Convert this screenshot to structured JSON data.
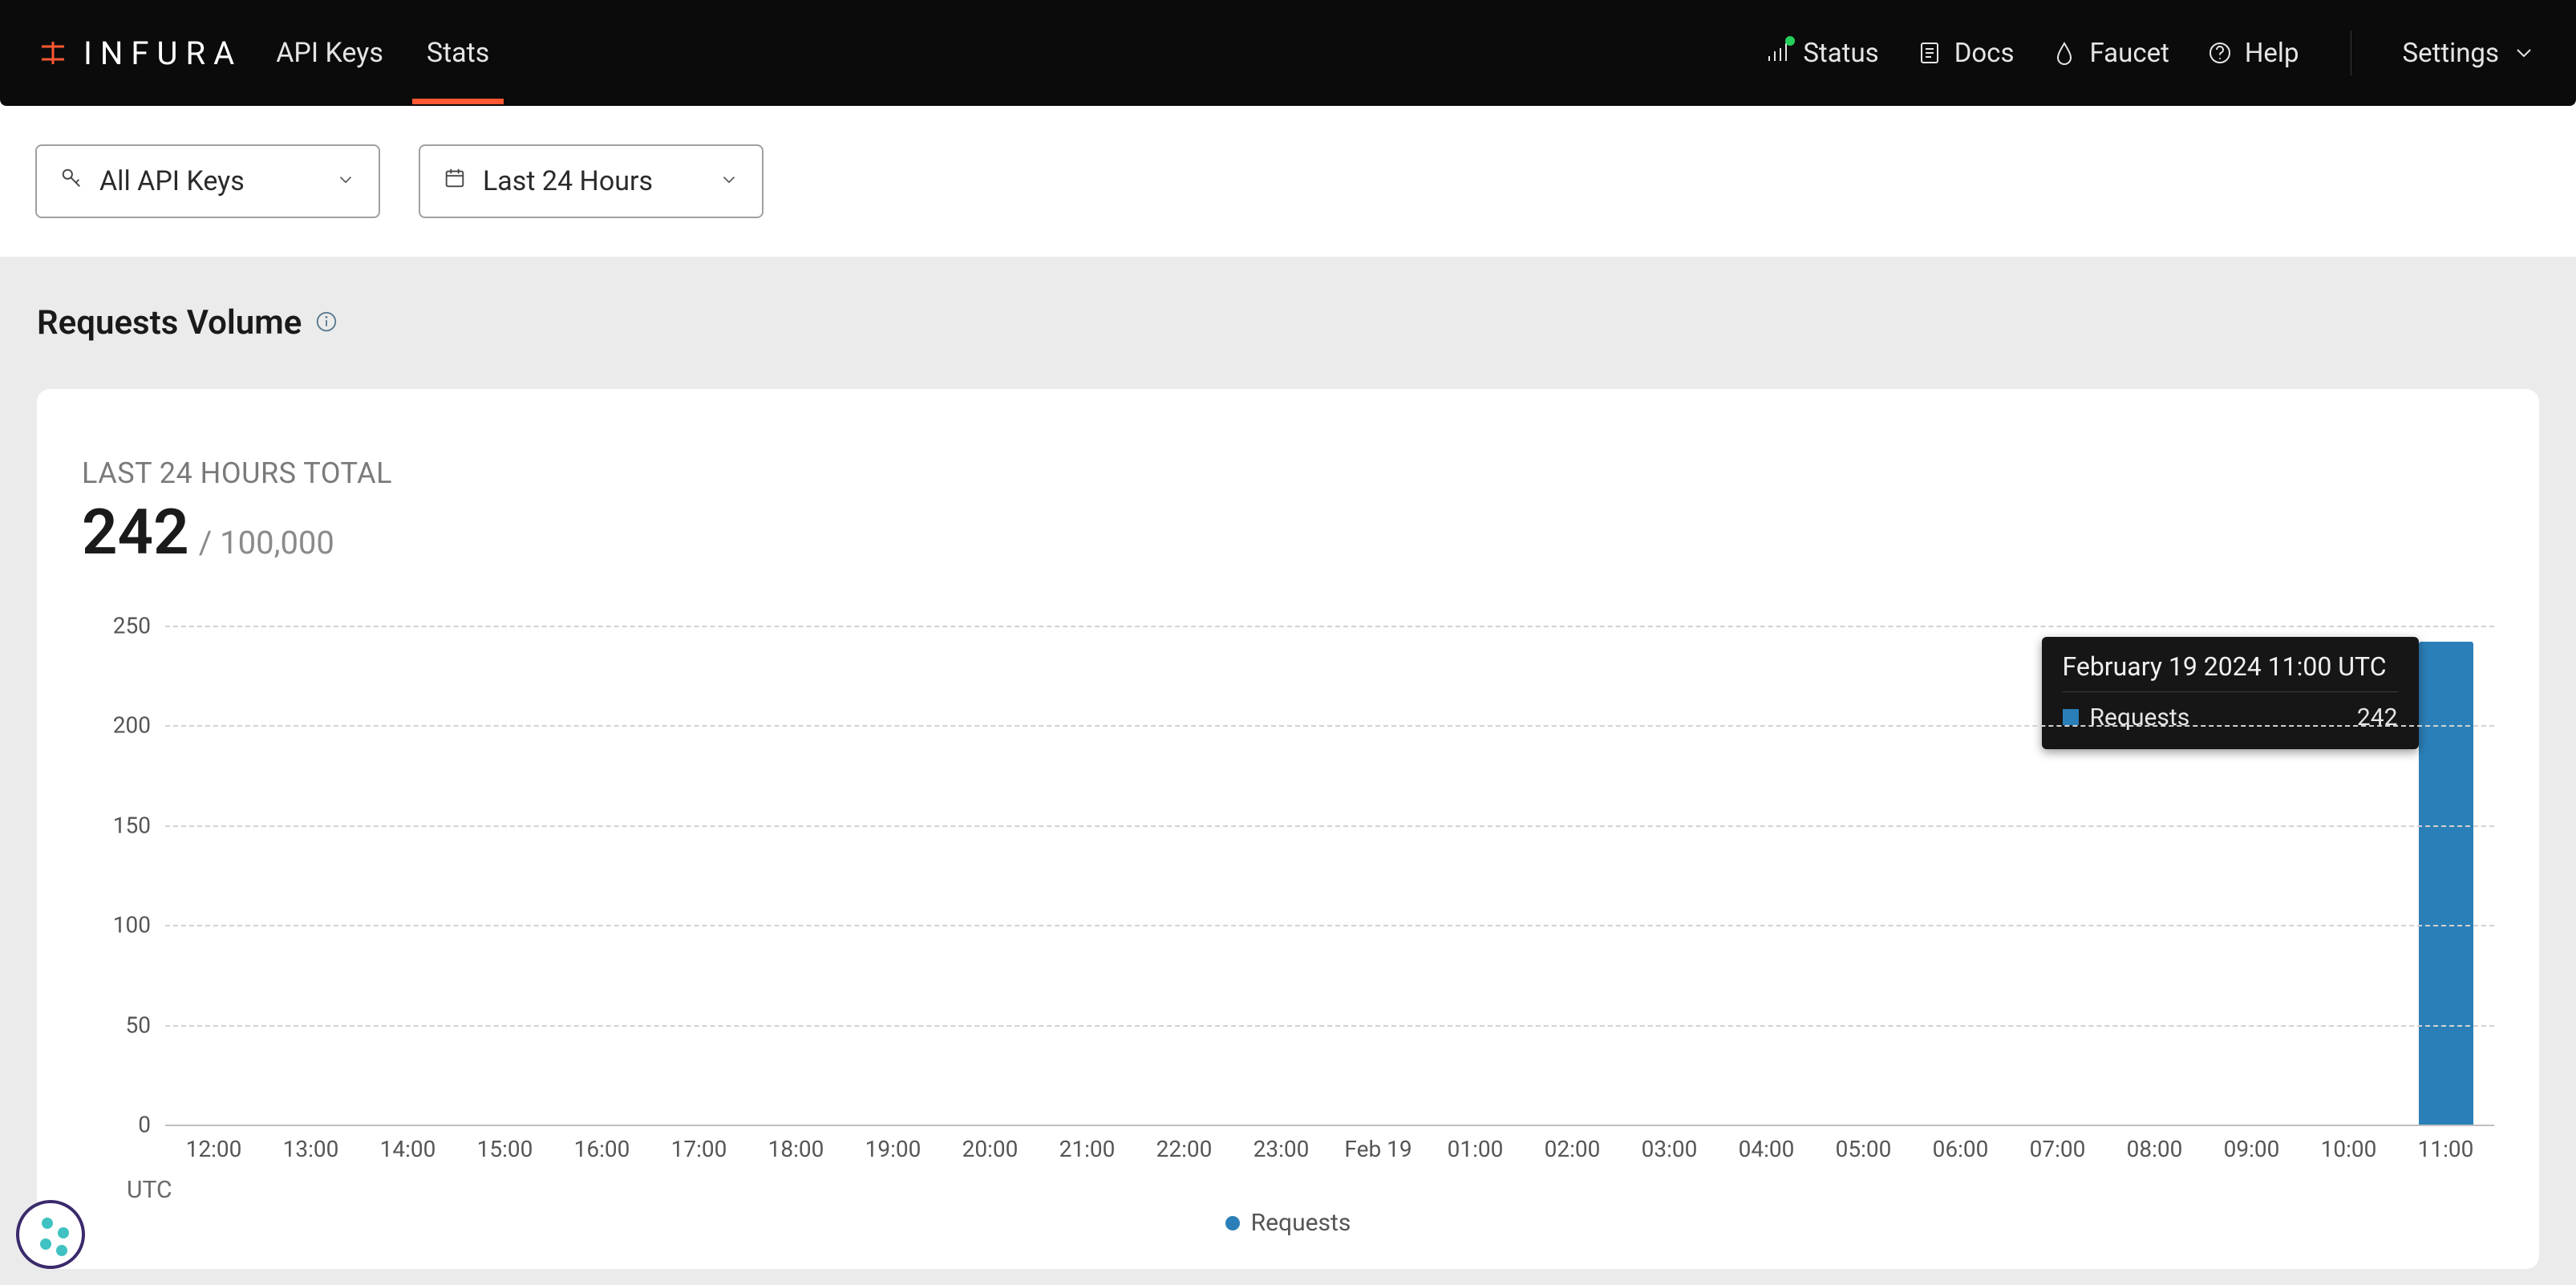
{
  "brand": {
    "name": "INFURA"
  },
  "nav": {
    "tabs": {
      "api_keys": "API Keys",
      "stats": "Stats"
    },
    "links": {
      "status": "Status",
      "docs": "Docs",
      "faucet": "Faucet",
      "help": "Help",
      "settings": "Settings"
    }
  },
  "filters": {
    "api_keys": {
      "label": "All API Keys"
    },
    "time_range": {
      "label": "Last 24 Hours"
    }
  },
  "section": {
    "title": "Requests Volume",
    "summary": {
      "subtitle": "LAST 24 HOURS TOTAL",
      "value": "242",
      "limit_prefix": "/ ",
      "limit": "100,000"
    }
  },
  "chart_data": {
    "type": "bar",
    "title": "Requests Volume",
    "xlabel": "UTC",
    "ylabel": "",
    "ylim": [
      0,
      250
    ],
    "y_ticks": [
      0,
      50,
      100,
      150,
      200,
      250
    ],
    "categories": [
      "12:00",
      "13:00",
      "14:00",
      "15:00",
      "16:00",
      "17:00",
      "18:00",
      "19:00",
      "20:00",
      "21:00",
      "22:00",
      "23:00",
      "Feb 19",
      "01:00",
      "02:00",
      "03:00",
      "04:00",
      "05:00",
      "06:00",
      "07:00",
      "08:00",
      "09:00",
      "10:00",
      "11:00"
    ],
    "series": [
      {
        "name": "Requests",
        "color": "#2b7fb8",
        "values": [
          0,
          0,
          0,
          0,
          0,
          0,
          0,
          0,
          0,
          0,
          0,
          0,
          0,
          0,
          0,
          0,
          0,
          0,
          0,
          0,
          0,
          0,
          0,
          242
        ]
      }
    ],
    "legend": {
      "label": "Requests"
    }
  },
  "tooltip": {
    "title": "February 19 2024 11:00 UTC",
    "metric_label": "Requests",
    "metric_value": "242"
  }
}
